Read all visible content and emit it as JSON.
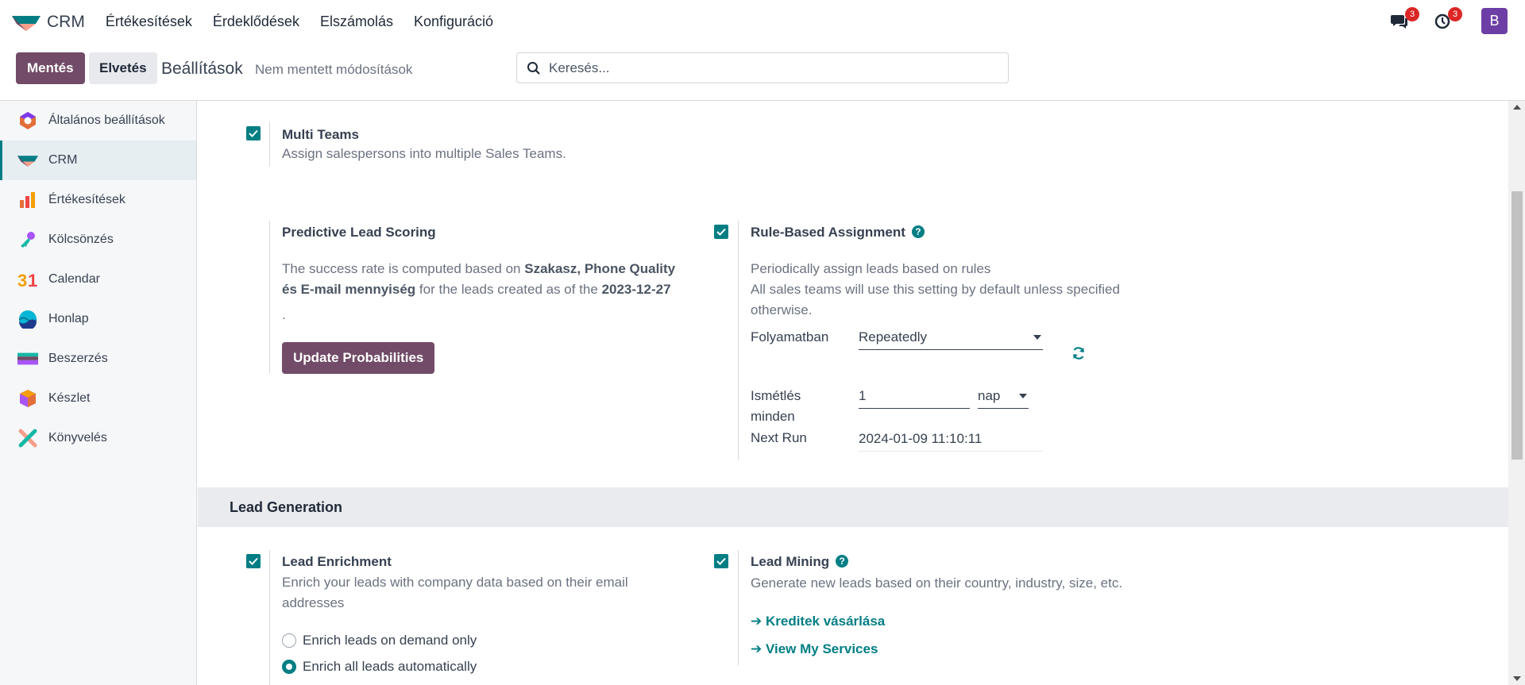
{
  "nav": {
    "app_name": "CRM",
    "menu": [
      "Értékesítések",
      "Érdeklődések",
      "Elszámolás",
      "Konfiguráció"
    ],
    "messages_count": "3",
    "activities_count": "3",
    "avatar_letter": "B"
  },
  "control": {
    "save_label": "Mentés",
    "discard_label": "Elvetés",
    "title": "Beállítások",
    "unsaved": "Nem mentett módosítások",
    "search_placeholder": "Keresés..."
  },
  "sidebar": {
    "items": [
      {
        "label": "Általános beállítások",
        "icon": "settings-icon"
      },
      {
        "label": "CRM",
        "icon": "crm-icon",
        "active": true
      },
      {
        "label": "Értékesítések",
        "icon": "sales-icon"
      },
      {
        "label": "Kölcsönzés",
        "icon": "rental-icon"
      },
      {
        "label": "Calendar",
        "icon": "calendar-icon"
      },
      {
        "label": "Honlap",
        "icon": "website-icon"
      },
      {
        "label": "Beszerzés",
        "icon": "purchase-icon"
      },
      {
        "label": "Készlet",
        "icon": "inventory-icon"
      },
      {
        "label": "Könyvelés",
        "icon": "accounting-icon"
      }
    ]
  },
  "multi_teams": {
    "title": "Multi Teams",
    "desc": "Assign salespersons into multiple Sales Teams.",
    "checked": true
  },
  "pls": {
    "title": "Predictive Lead Scoring",
    "desc_1": "The success rate is computed based on ",
    "desc_bold_1": "Szakasz, Phone Quality",
    "desc_bold_2": "és E-mail mennyiség",
    "desc_2": " for the leads created as of the ",
    "desc_bold_3": "2023-12-27",
    "desc_end": ".",
    "button": "Update Probabilities"
  },
  "rba": {
    "title": "Rule-Based Assignment",
    "desc_1": "Periodically assign leads based on rules",
    "desc_2": "All sales teams will use this setting by default unless specified otherwise.",
    "running_label": "Folyamatban",
    "running_value": "Repeatedly",
    "repeat_label": "Ismétlés minden",
    "repeat_value": "1",
    "repeat_unit": "nap",
    "next_run_label": "Next Run",
    "next_run_value": "2024-01-09 11:10:11",
    "checked": true
  },
  "lead_gen": {
    "header": "Lead Generation"
  },
  "enrichment": {
    "title": "Lead Enrichment",
    "desc": "Enrich your leads with company data based on their email addresses",
    "option_1": "Enrich leads on demand only",
    "option_2": "Enrich all leads automatically",
    "selected": 2,
    "checked": true
  },
  "mining": {
    "title": "Lead Mining",
    "desc": "Generate new leads based on their country, industry, size, etc.",
    "link_1": "Kreditek vásárlása",
    "link_2": "View My Services",
    "checked": true
  },
  "colors": {
    "primary": "#714b67",
    "accent": "#017e84",
    "badge": "#dc2626"
  }
}
